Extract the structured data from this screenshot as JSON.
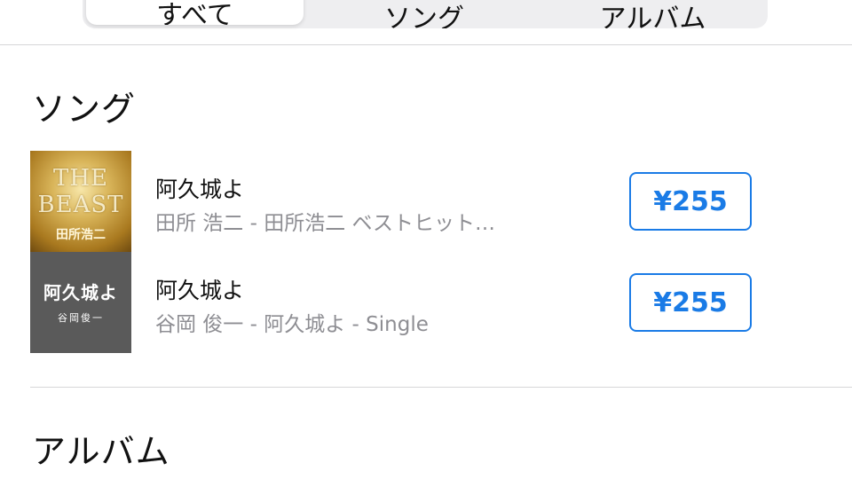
{
  "segments": {
    "all_label": "すべて",
    "songs_label": "ソング",
    "albums_label": "アルバム"
  },
  "songs_section": {
    "title": "ソング",
    "items": [
      {
        "title": "阿久城よ",
        "subtitle": "田所 浩二 - 田所浩二 ベストヒット…",
        "price": "¥255",
        "artwork": {
          "style": "gold",
          "line1": "THE",
          "line2": "BEAST",
          "line3": "田所浩二"
        }
      },
      {
        "title": "阿久城よ",
        "subtitle": "谷岡 俊一 - 阿久城よ - Single",
        "price": "¥255",
        "artwork": {
          "style": "dark",
          "title": "阿久城よ",
          "artist": "谷岡俊一"
        }
      }
    ]
  },
  "albums_section": {
    "title": "アルバム"
  },
  "colors": {
    "accent": "#1a7be6",
    "secondary_text": "#8e8e93",
    "divider": "#d6d6d8"
  }
}
